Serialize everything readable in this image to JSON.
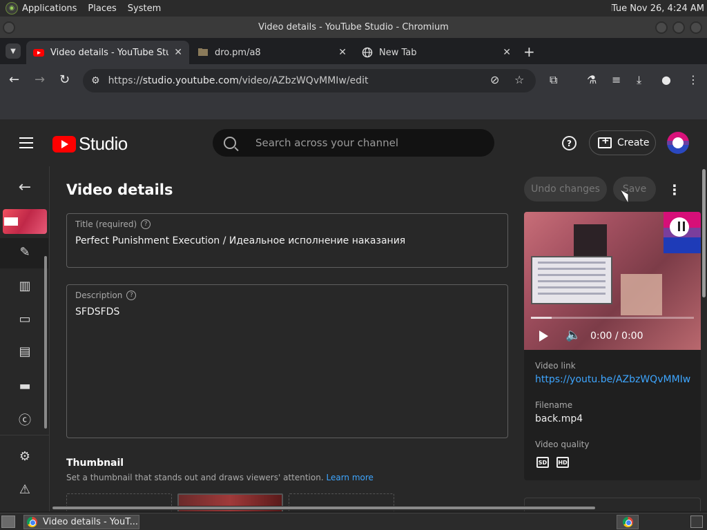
{
  "os": {
    "menus": [
      "Applications",
      "Places",
      "System"
    ],
    "clock": "Tue Nov 26,  4:24 AM"
  },
  "window": {
    "title": "Video details - YouTube Studio - Chromium"
  },
  "tabs": [
    {
      "label": "Video details - YouTube Stud",
      "favicon": "youtube-icon",
      "active": true
    },
    {
      "label": "dro.pm/a8",
      "favicon": "folder-icon",
      "active": false
    },
    {
      "label": "New Tab",
      "favicon": "globe-icon",
      "active": false
    }
  ],
  "address": {
    "prefix": "https://",
    "host": "studio.youtube.com",
    "path": "/video/AZbzWQvMMIw/edit"
  },
  "studio": {
    "brand": "Studio",
    "search_placeholder": "Search across your channel",
    "create_label": "Create",
    "help_glyph": "?"
  },
  "page": {
    "title": "Video details",
    "undo_label": "Undo changes",
    "save_label": "Save",
    "title_field": {
      "label": "Title (required)",
      "value": "Perfect Punishment Execution / Идеальное исполнение наказания"
    },
    "description_field": {
      "label": "Description",
      "value": "SFDSFDS"
    },
    "thumbnail": {
      "heading": "Thumbnail",
      "subtitle": "Set a thumbnail that stands out and draws viewers' attention.",
      "learn_more": "Learn more"
    }
  },
  "side": {
    "time": "0:00 / 0:00",
    "video_link_label": "Video link",
    "video_link": "https://youtu.be/AZbzWQvMMIw",
    "filename_label": "Filename",
    "filename": "back.mp4",
    "quality_label": "Video quality",
    "qualities": [
      "SD",
      "HD"
    ]
  },
  "taskbar": {
    "item": "Video details - YouT..."
  },
  "colors": {
    "accent_link": "#3ea6ff",
    "youtube_red": "#ff0000",
    "background": "#282828"
  }
}
